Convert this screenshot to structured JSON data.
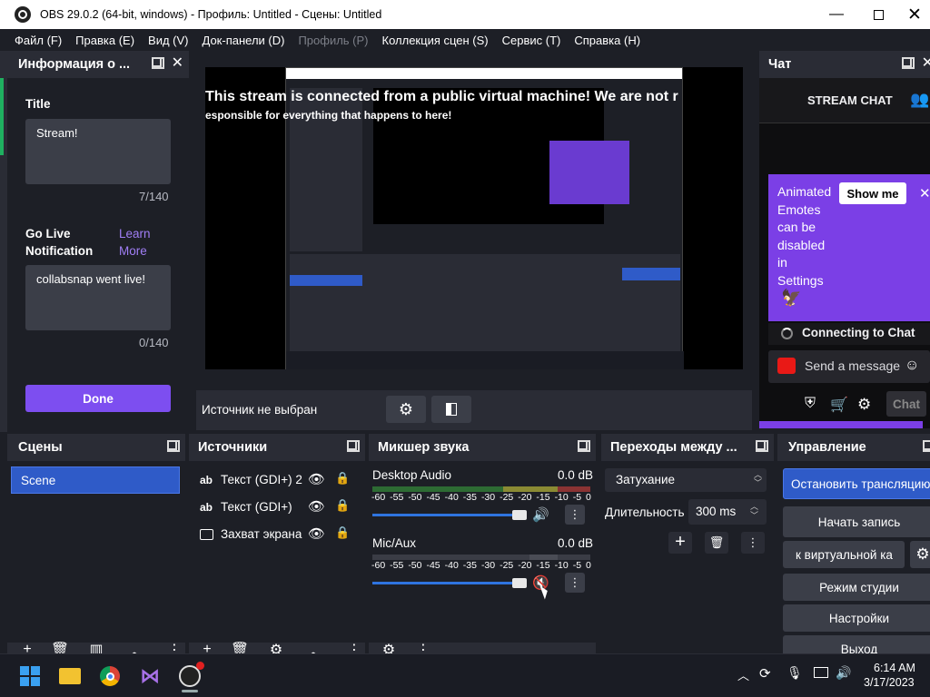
{
  "window": {
    "title": "OBS 29.0.2 (64-bit, windows) - Профиль: Untitled - Сцены: Untitled"
  },
  "menu": [
    "Файл (F)",
    "Правка (E)",
    "Вид (V)",
    "Док-панели (D)",
    "Профиль (P)",
    "Коллекция сцен (S)",
    "Сервис (T)",
    "Справка (H)"
  ],
  "info_dock": {
    "title": "Информация о ...",
    "title_label": "Title",
    "title_value": "Stream!",
    "title_count": "7/140",
    "golive_label": "Go Live Notification",
    "learn_more": "Learn More",
    "golive_value": "collabsnap went live!",
    "golive_count": "0/140",
    "done_label": "Done"
  },
  "preview": {
    "overlay_line1": "This stream is connected from a public virtual machine! We are not r",
    "overlay_line2": "esponsible for everything that happens to here!"
  },
  "source_bar": {
    "label": "Источник не выбран"
  },
  "chat": {
    "title": "Чат",
    "stream_chat": "STREAM CHAT",
    "promo_text": "Animated Emotes can be disabled in Settings",
    "show_me": "Show me",
    "connecting": "Connecting to Chat",
    "send_placeholder": "Send a message",
    "chat_button": "Chat"
  },
  "scenes": {
    "title": "Сцены",
    "items": [
      "Scene"
    ]
  },
  "sources": {
    "title": "Источники",
    "items": [
      "Текст (GDI+) 2",
      "Текст (GDI+)",
      "Захват экрана"
    ]
  },
  "mixer": {
    "title": "Микшер звука",
    "channels": [
      {
        "name": "Desktop Audio",
        "db": "0.0 dB",
        "muted": false
      },
      {
        "name": "Mic/Aux",
        "db": "0.0 dB",
        "muted": true
      }
    ],
    "scale": [
      "-60",
      "-55",
      "-50",
      "-45",
      "-40",
      "-35",
      "-30",
      "-25",
      "-20",
      "-15",
      "-10",
      "-5",
      "0"
    ]
  },
  "transitions": {
    "title": "Переходы между ...",
    "selected": "Затухание",
    "duration_label": "Длительность",
    "duration_value": "300 ms"
  },
  "controls": {
    "title": "Управление",
    "stop_stream": "Остановить трансляцию",
    "start_record": "Начать запись",
    "virtual_cam": "к виртуальной ка",
    "studio_mode": "Режим студии",
    "settings": "Настройки",
    "exit": "Выход"
  },
  "taskbar": {
    "time": "6:14 AM",
    "date": "3/17/2023"
  }
}
